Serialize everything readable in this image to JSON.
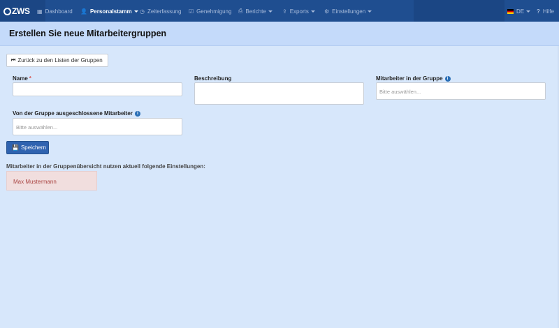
{
  "nav": {
    "brand": "ZWS",
    "items": [
      {
        "label": "Dashboard",
        "icon": "grid-icon",
        "glyph": "▦"
      },
      {
        "label": "Personalstamm",
        "icon": "user-icon",
        "glyph": "👤"
      },
      {
        "label": "Zeiterfassung",
        "icon": "clock-icon",
        "glyph": "◷"
      },
      {
        "label": "Genehmigung",
        "icon": "check-icon",
        "glyph": "☑"
      },
      {
        "label": "Berichte",
        "icon": "print-icon",
        "glyph": "⎙"
      },
      {
        "label": "Exports",
        "icon": "export-icon",
        "glyph": "⇪"
      },
      {
        "label": "Einstellungen",
        "icon": "gear-icon",
        "glyph": "⚙"
      }
    ],
    "language": "DE",
    "help": "Hilfe",
    "help_glyph": "?"
  },
  "page": {
    "title": "Erstellen Sie neue Mitarbeitergruppen",
    "back_button": "Zurück zu den Listen der Gruppen",
    "back_glyph": "⏮"
  },
  "form": {
    "name_label": "Name",
    "name_required": "*",
    "name_value": "",
    "description_label": "Beschreibung",
    "description_value": "",
    "members_label": "Mitarbeiter in der Gruppe",
    "members_placeholder": "Bitte auswählen...",
    "excluded_label": "Von der Gruppe ausgeschlossene Mitarbeiter",
    "excluded_placeholder": "Bitte auswählen...",
    "info_glyph": "i",
    "save_button": "Speichern",
    "save_glyph": "💾"
  },
  "overview": {
    "text": "Mitarbeiter in der Gruppenübersicht nutzen aktuell folgende Einstellungen:",
    "alert_item": "Max Mustermann"
  },
  "colors": {
    "navbar": "#1f4e90",
    "header": "#c4dafa",
    "background": "#d7e7fb",
    "primary": "#2f63b0",
    "alert_bg": "#f1dede",
    "alert_text": "#a94442"
  }
}
